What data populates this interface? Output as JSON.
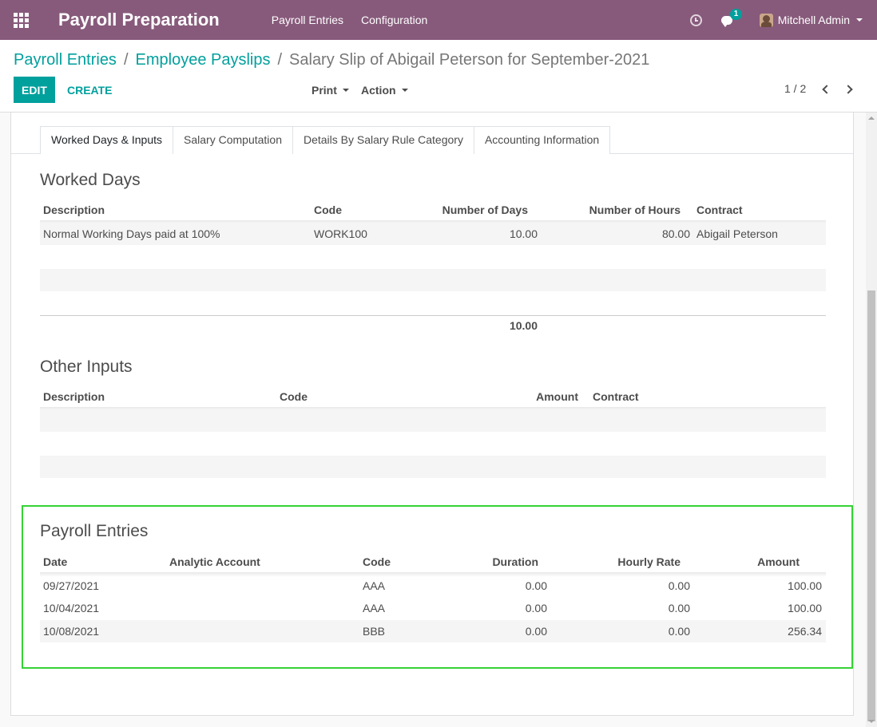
{
  "navbar": {
    "app_title": "Payroll Preparation",
    "menu": [
      "Payroll Entries",
      "Configuration"
    ],
    "chat_count": "1",
    "user_name": "Mitchell Admin",
    "bg_color": "#875a7b"
  },
  "breadcrumb": {
    "items": [
      "Payroll Entries",
      "Employee Payslips"
    ],
    "current": "Salary Slip of Abigail Peterson for September-2021"
  },
  "toolbar": {
    "edit_label": "EDIT",
    "create_label": "CREATE",
    "print_label": "Print",
    "action_label": "Action",
    "pager": "1 / 2",
    "accent_color": "#00a09d"
  },
  "tabs": [
    "Worked Days & Inputs",
    "Salary Computation",
    "Details By Salary Rule Category",
    "Accounting Information"
  ],
  "worked_days": {
    "title": "Worked Days",
    "headers": [
      "Description",
      "Code",
      "Number of Days",
      "Number of Hours",
      "Contract"
    ],
    "rows": [
      {
        "description": "Normal Working Days paid at 100%",
        "code": "WORK100",
        "days": "10.00",
        "hours": "80.00",
        "contract": "Abigail Peterson"
      }
    ],
    "total_days": "10.00"
  },
  "other_inputs": {
    "title": "Other Inputs",
    "headers": [
      "Description",
      "Code",
      "Amount",
      "Contract"
    ]
  },
  "payroll_entries": {
    "title": "Payroll Entries",
    "headers": [
      "Date",
      "Analytic Account",
      "Code",
      "Duration",
      "Hourly Rate",
      "Amount"
    ],
    "rows": [
      {
        "date": "09/27/2021",
        "analytic": "",
        "code": "AAA",
        "duration": "0.00",
        "rate": "0.00",
        "amount": "100.00"
      },
      {
        "date": "10/04/2021",
        "analytic": "",
        "code": "AAA",
        "duration": "0.00",
        "rate": "0.00",
        "amount": "100.00"
      },
      {
        "date": "10/08/2021",
        "analytic": "",
        "code": "BBB",
        "duration": "0.00",
        "rate": "0.00",
        "amount": "256.34"
      }
    ],
    "highlight_color": "#35d235"
  }
}
